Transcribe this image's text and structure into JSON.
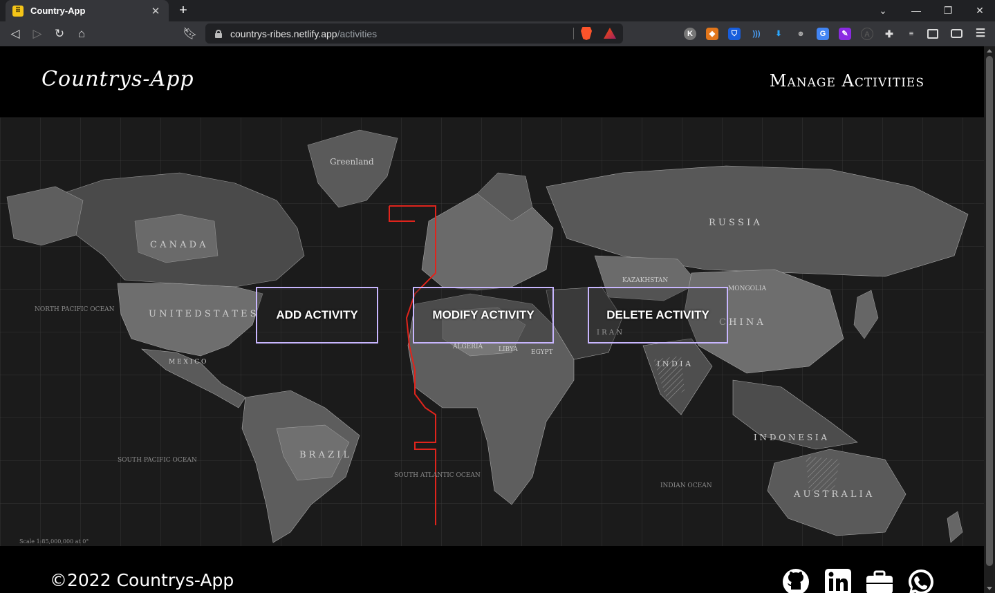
{
  "browser": {
    "tab_title": "Country-App",
    "tab_favicon": "⠿",
    "url_host": "countrys-ribes.netlify.app",
    "url_path": "/activities"
  },
  "header": {
    "brand": "Countrys-App",
    "nav_link": "Manage Activities"
  },
  "actions": {
    "add": "ADD ACTIVITY",
    "modify": "MODIFY ACTIVITY",
    "delete": "DELETE ACTIVITY"
  },
  "map_labels": {
    "canada": "C A N A D A",
    "usa": "U N I T E D   S T A T E S",
    "greenland": "Greenland",
    "russia": "R U S S I A",
    "china": "C H I N A",
    "brazil": "B R A Z I L",
    "australia": "A U S T R A L I A",
    "indonesia": "I N D O N E S I A",
    "india": "I N D I A",
    "mexico": "M E X I C O",
    "kazakhstan": "KAZAKHSTAN",
    "mongolia": "MONGOLIA",
    "iran": "I R A N",
    "algeria": "ALGERIA",
    "libya": "LIBYA",
    "egypt": "EGYPT",
    "north_pacific": "NORTH PACIFIC OCEAN",
    "south_pacific": "SOUTH PACIFIC OCEAN",
    "south_atlantic": "SOUTH ATLANTIC OCEAN",
    "indian_ocean": "INDIAN OCEAN",
    "scale": "Scale 1:85,000,000 at 0°"
  },
  "footer": {
    "copyright": "©2022 Countrys-App"
  },
  "colors": {
    "button_border": "#c8b6ff",
    "map_background": "#1b1b1b",
    "land_light": "#6b6b6b",
    "land_dark": "#3a3a3a",
    "timezone_line": "#e0241c"
  }
}
